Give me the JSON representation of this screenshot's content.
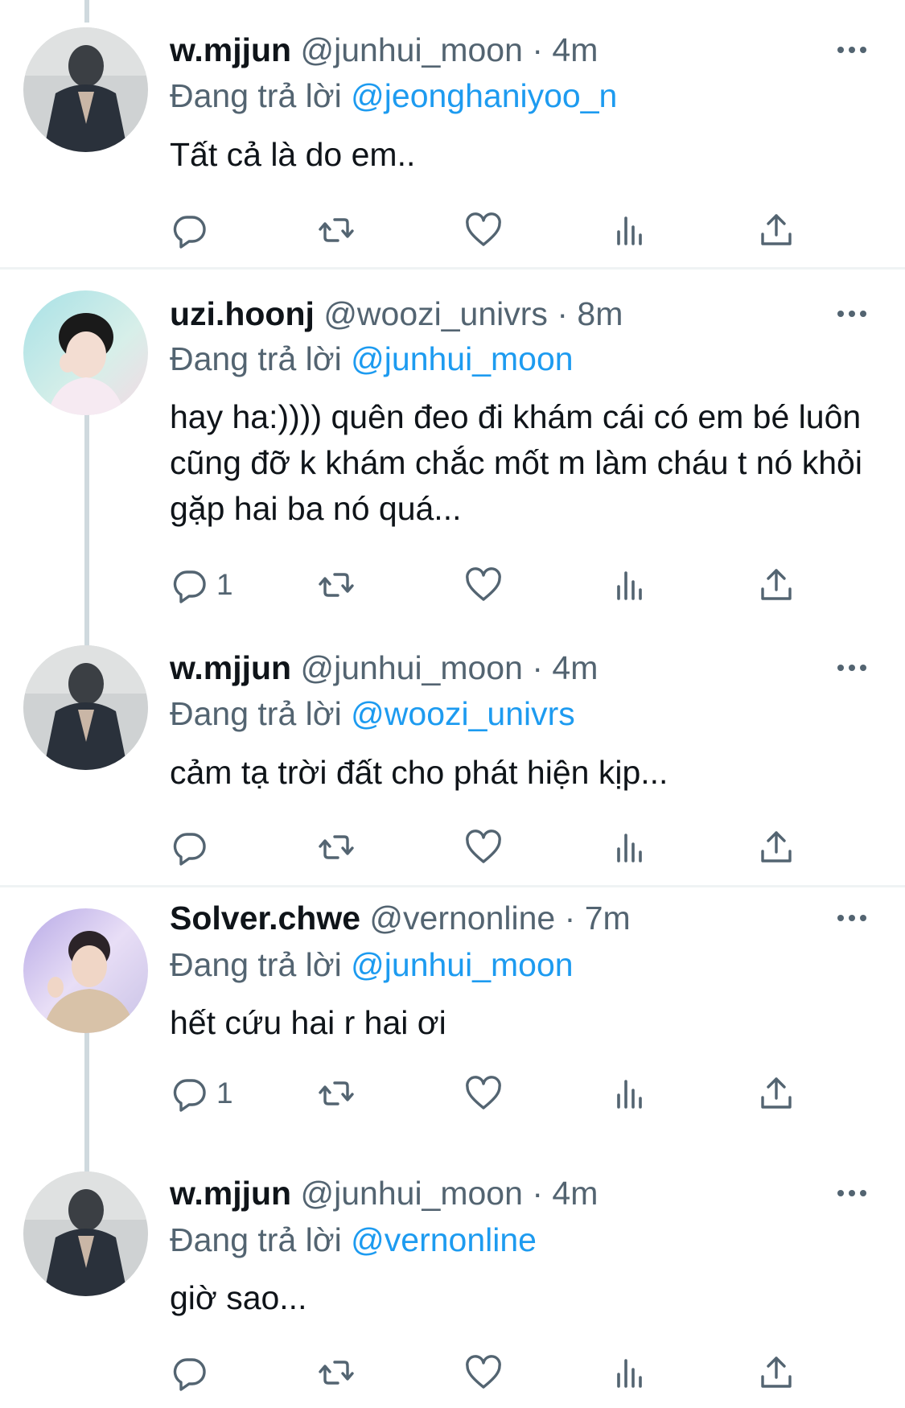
{
  "reply_prefix": "Đang trả lời",
  "tweets": [
    {
      "name": "w.mjjun",
      "handle": "@junhui_moon",
      "separator": "·",
      "time": "4m",
      "reply_mention": "@jeonghaniyoo_n",
      "text": "Tất cả là do em..",
      "reply_count": "",
      "avatar_colors": [
        "#cfd2d3",
        "#2a313b"
      ]
    },
    {
      "name": "uzi.hoonj",
      "handle": "@woozi_univrs",
      "separator": "·",
      "time": "8m",
      "reply_mention": "@junhui_moon",
      "text": "hay ha:)))) quên đeo đi khám cái có em bé luôn cũng đỡ k khám chắc mốt m làm cháu t nó khỏi gặp hai ba nó quá...",
      "reply_count": "1",
      "avatar_colors": [
        "#bfe3e2",
        "#1a1a1a"
      ]
    },
    {
      "name": "w.mjjun",
      "handle": "@junhui_moon",
      "separator": "·",
      "time": "4m",
      "reply_mention": "@woozi_univrs",
      "text": "cảm tạ trời đất cho phát hiện kịp...",
      "reply_count": "",
      "avatar_colors": [
        "#cfd2d3",
        "#2a313b"
      ]
    },
    {
      "name": "Solver.chwe",
      "handle": "@vernonline",
      "separator": "·",
      "time": "7m",
      "reply_mention": "@junhui_moon",
      "text": "hết cứu hai r hai ơi",
      "reply_count": "1",
      "avatar_colors": [
        "#c9c2e6",
        "#2b2328"
      ]
    },
    {
      "name": "w.mjjun",
      "handle": "@junhui_moon",
      "separator": "·",
      "time": "4m",
      "reply_mention": "@vernonline",
      "text": "giờ sao...",
      "reply_count": "",
      "avatar_colors": [
        "#cfd2d3",
        "#2a313b"
      ]
    }
  ],
  "icons": {
    "reply": "reply-icon",
    "retweet": "retweet-icon",
    "like": "heart-icon",
    "views": "views-chart-icon",
    "share": "share-icon",
    "more": "more-dots-icon"
  },
  "colors": {
    "mention": "#1d9bf0",
    "secondary_text": "#536471",
    "primary_text": "#0f1419",
    "thread_line": "#cfd9de"
  }
}
